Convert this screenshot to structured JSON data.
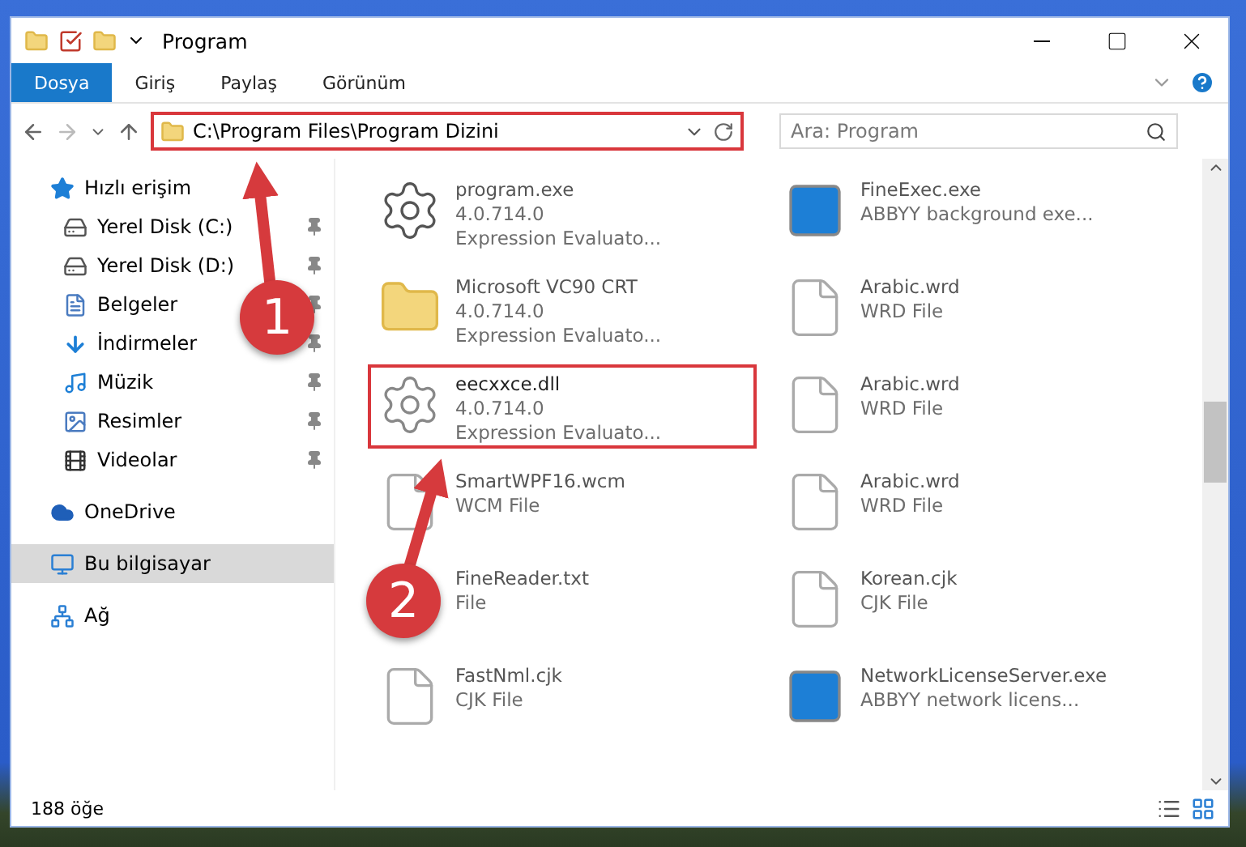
{
  "window": {
    "title": "Program"
  },
  "ribbon_tabs": [
    {
      "label": "Dosya",
      "selected": true
    },
    {
      "label": "Giriş",
      "selected": false
    },
    {
      "label": "Paylaş",
      "selected": false
    },
    {
      "label": "Görünüm",
      "selected": false
    }
  ],
  "address_bar": {
    "path": "C:\\Program Files\\Program Dizini",
    "highlighted": true
  },
  "search": {
    "placeholder": "Ara: Program"
  },
  "sidebar": {
    "items": [
      {
        "label": "Hızlı erişim",
        "kind": "star",
        "selected": false,
        "children": [
          {
            "label": "Yerel Disk (C:)",
            "kind": "drive-c",
            "pinned": true,
            "selected": false
          },
          {
            "label": "Yerel Disk (D:)",
            "kind": "drive",
            "pinned": true,
            "selected": false
          },
          {
            "label": "Belgeler",
            "kind": "document",
            "pinned": true,
            "selected": false
          },
          {
            "label": "İndirmeler",
            "kind": "download",
            "pinned": true,
            "selected": false
          },
          {
            "label": "Müzik",
            "kind": "music",
            "pinned": true,
            "selected": false
          },
          {
            "label": "Resimler",
            "kind": "picture",
            "pinned": true,
            "selected": false
          },
          {
            "label": "Videolar",
            "kind": "film",
            "pinned": true,
            "selected": false
          }
        ]
      },
      {
        "label": "OneDrive",
        "kind": "cloud",
        "selected": false
      },
      {
        "label": "Bu bilgisayar",
        "kind": "computer",
        "selected": true
      },
      {
        "label": "Ağ",
        "kind": "network",
        "selected": false
      }
    ]
  },
  "files": [
    {
      "name": "program.exe",
      "details": [
        "4.0.714.0",
        "Expression Evaluato..."
      ],
      "kind": "app",
      "highlighted": false
    },
    {
      "name": "Microsoft VC90 CRT",
      "details": [
        "4.0.714.0",
        "Expression Evaluato..."
      ],
      "kind": "folder",
      "highlighted": false
    },
    {
      "name": "eecxxce.dll",
      "details": [
        "4.0.714.0",
        "Expression Evaluato..."
      ],
      "kind": "dll",
      "highlighted": true
    },
    {
      "name": "SmartWPF16.wcm",
      "details": [
        "WCM File"
      ],
      "kind": "doc",
      "highlighted": false
    },
    {
      "name": "FineReader.txt",
      "details": [
        "File"
      ],
      "kind": "doc",
      "highlighted": false
    },
    {
      "name": "FastNml.cjk",
      "details": [
        "CJK File"
      ],
      "kind": "doc",
      "highlighted": false
    },
    {
      "name": "FineExec.exe",
      "details": [
        "ABBYY background exe..."
      ],
      "kind": "window",
      "highlighted": false
    },
    {
      "name": "Arabic.wrd",
      "details": [
        "WRD File"
      ],
      "kind": "doc",
      "highlighted": false
    },
    {
      "name": "Arabic.wrd",
      "details": [
        "WRD File"
      ],
      "kind": "doc",
      "highlighted": false
    },
    {
      "name": "Arabic.wrd",
      "details": [
        "WRD File"
      ],
      "kind": "doc",
      "highlighted": false
    },
    {
      "name": "Korean.cjk",
      "details": [
        "CJK File"
      ],
      "kind": "doc",
      "highlighted": false
    },
    {
      "name": "NetworkLicenseServer.exe",
      "details": [
        "ABBYY network licens..."
      ],
      "kind": "window",
      "highlighted": false
    }
  ],
  "status_bar": {
    "item_count": "188 öğe"
  },
  "annotations": [
    {
      "number": "1"
    },
    {
      "number": "2"
    }
  ]
}
